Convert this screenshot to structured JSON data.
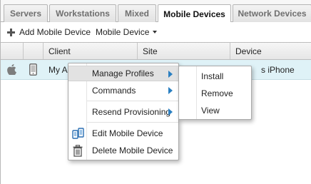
{
  "tabs": [
    "Servers",
    "Workstations",
    "Mixed",
    "Mobile Devices",
    "Network Devices"
  ],
  "active_tab": "Mobile Devices",
  "toolbar": {
    "add_label": "Add Mobile Device",
    "device_menu_label": "Mobile Device"
  },
  "table": {
    "columns": [
      "Client",
      "Site",
      "Device"
    ],
    "row": {
      "os_icon": "apple-icon",
      "device_icon": "smartphone-icon",
      "client": "My Au",
      "device": "s iPhone"
    }
  },
  "context_menu": {
    "items": [
      "Manage Profiles",
      "Commands",
      "Resend Provisioning",
      "Edit Mobile Device",
      "Delete Mobile Device"
    ],
    "highlighted": "Manage Profiles",
    "icons": {
      "edit": "edit-device-icon",
      "delete": "trash-icon"
    },
    "arrow_color": "#2a7fc1"
  },
  "submenu": {
    "items": [
      "Install",
      "Remove",
      "View"
    ]
  },
  "colors": {
    "selected_row": "#dff2f7",
    "menu_highlight": "#e2e2e2"
  }
}
